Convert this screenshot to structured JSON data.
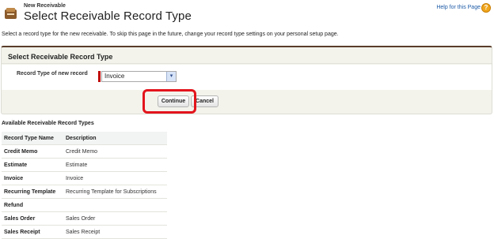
{
  "header": {
    "breadcrumb": "New Receivable",
    "title": "Select Receivable Record Type",
    "help_label": "Help for this Page",
    "help_icon": "?"
  },
  "intro_text": "Select a record type for the new receivable. To skip this page in the future, change your record type settings on your personal setup page.",
  "panel": {
    "title": "Select Receivable Record Type",
    "field_label": "Record Type of new record",
    "select_value": "Invoice",
    "select_arrow": "▾",
    "continue_label": "Continue",
    "cancel_label": "Cancel"
  },
  "types_section": {
    "title": "Available Receivable Record Types",
    "columns": [
      "Record Type Name",
      "Description"
    ],
    "rows": [
      {
        "name": "Credit Memo",
        "description": "Credit Memo"
      },
      {
        "name": "Estimate",
        "description": "Estimate"
      },
      {
        "name": "Invoice",
        "description": "Invoice"
      },
      {
        "name": "Recurring Template",
        "description": "Recurring Template for Subscriptions"
      },
      {
        "name": "Refund",
        "description": ""
      },
      {
        "name": "Sales Order",
        "description": "Sales Order"
      },
      {
        "name": "Sales Receipt",
        "description": "Sales Receipt"
      }
    ]
  },
  "colors": {
    "accent": "#5a3d2b",
    "required": "#c00000",
    "highlight": "#e3141c",
    "link": "#1d5aa6"
  }
}
